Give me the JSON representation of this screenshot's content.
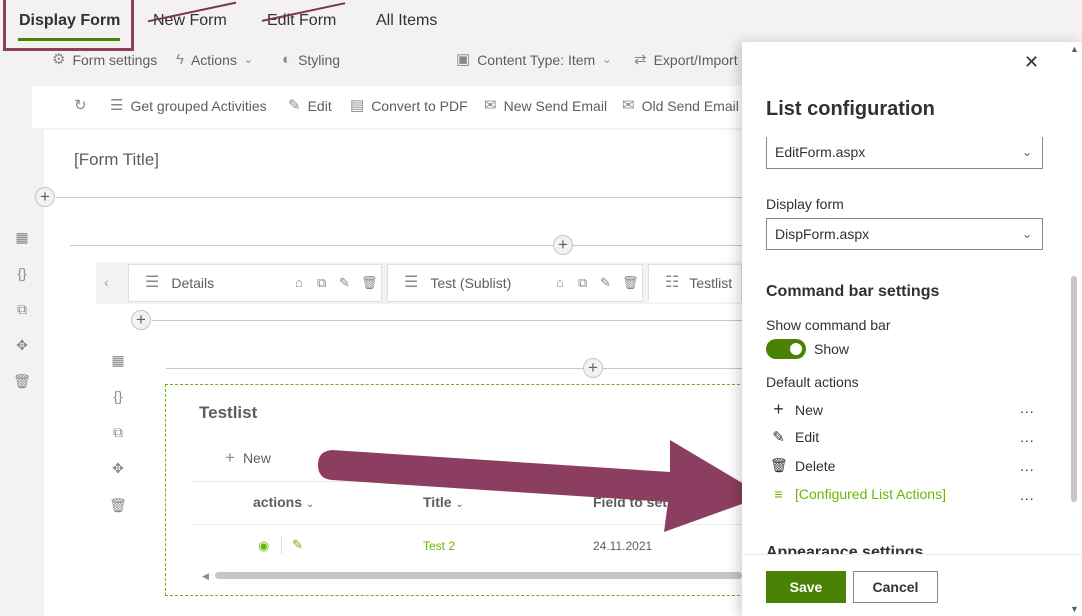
{
  "tabs": [
    {
      "label": "Display Form",
      "active": true,
      "struck": false
    },
    {
      "label": "New Form",
      "active": false,
      "struck": true
    },
    {
      "label": "Edit Form",
      "active": false,
      "struck": true
    },
    {
      "label": "All Items",
      "active": false,
      "struck": false
    }
  ],
  "toolbar": {
    "form_settings": "Form settings",
    "actions": "Actions",
    "styling": "Styling",
    "content_type": "Content Type: Item",
    "export_import": "Export/Import"
  },
  "command_bar": {
    "get_grouped": "Get grouped Activities",
    "edit": "Edit",
    "convert_pdf": "Convert to PDF",
    "new_send_email": "New Send Email",
    "old_send_email": "Old Send Email"
  },
  "form": {
    "title": "[Form Title]",
    "tabs": [
      {
        "label": "Details"
      },
      {
        "label": "Test (Sublist)"
      },
      {
        "label": "Testlist"
      }
    ],
    "list": {
      "title": "Testlist",
      "new_label": "New",
      "columns": [
        "actions",
        "Title",
        "Field to set"
      ],
      "rows": [
        {
          "title": "Test 2",
          "field": "24.11.2021"
        }
      ]
    }
  },
  "panel": {
    "title": "List configuration",
    "edit_form_value": "EditForm.aspx",
    "display_form_label": "Display form",
    "display_form_value": "DispForm.aspx",
    "command_bar_heading": "Command bar settings",
    "show_command_bar_label": "Show command bar",
    "show_toggle_label": "Show",
    "show_toggle_on": true,
    "default_actions_label": "Default actions",
    "actions": [
      {
        "label": "New",
        "icon": "plus-icon"
      },
      {
        "label": "Edit",
        "icon": "pencil-icon"
      },
      {
        "label": "Delete",
        "icon": "trash-icon"
      },
      {
        "label": "[Configured List Actions]",
        "icon": "list-actions-icon",
        "highlight": true
      }
    ],
    "more_label": "...",
    "appearance_heading": "Appearance settings",
    "save_label": "Save",
    "cancel_label": "Cancel"
  },
  "colors": {
    "accent": "#498205",
    "highlight_text": "#6bb700",
    "annotation": "#8c3e60"
  }
}
